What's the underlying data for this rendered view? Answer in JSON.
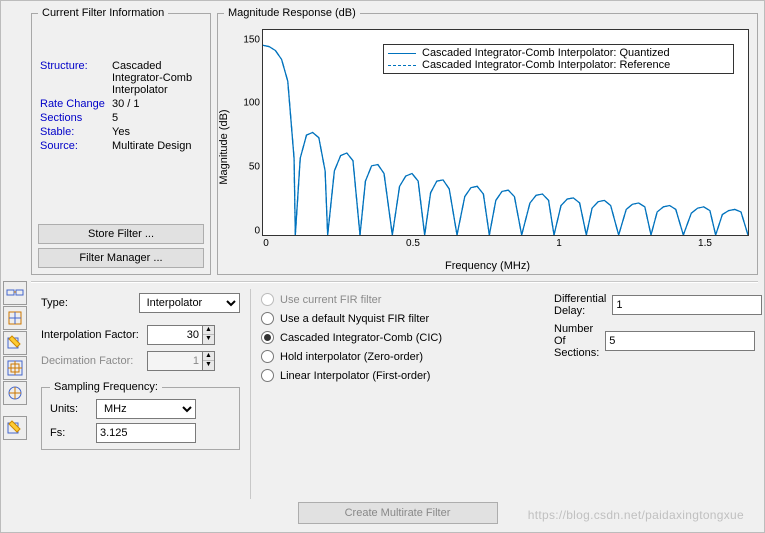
{
  "info_panel": {
    "legend": "Current Filter Information",
    "fields": {
      "structure_key": "Structure:",
      "structure_val": "Cascaded Integrator-Comb Interpolator",
      "rate_key": "Rate Change",
      "rate_val": "30 / 1",
      "sections_key": "Sections",
      "sections_val": "5",
      "stable_key": "Stable:",
      "stable_val": "Yes",
      "source_key": "Source:",
      "source_val": "Multirate Design"
    },
    "store_button": "Store Filter ...",
    "manager_button": "Filter Manager ..."
  },
  "chart": {
    "legend_title": "Magnitude Response (dB)",
    "ylabel": "Magnitude (dB)",
    "xlabel": "Frequency (MHz)",
    "xticks": [
      "0",
      "0.5",
      "1",
      "1.5"
    ],
    "yticks": [
      "0",
      "50",
      "100",
      "150"
    ],
    "legend_entries": {
      "q": "Cascaded Integrator-Comb Interpolator: Quantized",
      "r": "Cascaded Integrator-Comb Interpolator: Reference"
    }
  },
  "chart_data": {
    "type": "line",
    "title": "Magnitude Response (dB)",
    "xlabel": "Frequency (MHz)",
    "ylabel": "Magnitude (dB)",
    "xlim": [
      0,
      1.5625
    ],
    "ylim": [
      0,
      160
    ],
    "series": [
      {
        "name": "Cascaded Integrator-Comb Interpolator: Quantized",
        "style": "solid",
        "x": [
          0.0,
          0.02,
          0.04,
          0.06,
          0.08,
          0.1,
          0.1042,
          0.12,
          0.14,
          0.16,
          0.18,
          0.2,
          0.2083,
          0.23,
          0.25,
          0.27,
          0.29,
          0.3125,
          0.33,
          0.35,
          0.37,
          0.39,
          0.4167,
          0.44,
          0.46,
          0.48,
          0.5,
          0.5208,
          0.54,
          0.56,
          0.58,
          0.6,
          0.625,
          0.65,
          0.67,
          0.69,
          0.71,
          0.7292,
          0.75,
          0.77,
          0.79,
          0.81,
          0.8333,
          0.86,
          0.88,
          0.9,
          0.92,
          0.9375,
          0.96,
          0.98,
          1.0,
          1.02,
          1.0417,
          1.06,
          1.08,
          1.1,
          1.12,
          1.1458,
          1.17,
          1.19,
          1.21,
          1.23,
          1.25,
          1.27,
          1.29,
          1.31,
          1.33,
          1.3542,
          1.38,
          1.4,
          1.42,
          1.44,
          1.4583,
          1.48,
          1.5,
          1.52,
          1.54,
          1.5625
        ],
        "y": [
          148,
          147,
          144,
          137,
          120,
          60,
          0,
          60,
          78,
          80,
          76,
          50,
          0,
          50,
          62,
          64,
          58,
          0,
          42,
          54,
          55,
          48,
          0,
          38,
          46,
          48,
          42,
          0,
          33,
          42,
          43,
          36,
          0,
          30,
          37,
          38,
          32,
          0,
          27,
          34,
          35,
          30,
          0,
          25,
          31,
          32,
          27,
          0,
          23,
          28,
          29,
          25,
          0,
          21,
          26,
          27,
          23,
          0,
          20,
          24,
          25,
          22,
          0,
          18,
          22,
          23,
          20,
          0,
          17,
          21,
          22,
          19,
          0,
          16,
          19,
          20,
          18,
          0
        ]
      },
      {
        "name": "Cascaded Integrator-Comb Interpolator: Reference",
        "style": "dash-dot",
        "x": [
          0.0,
          0.02,
          0.04,
          0.06,
          0.08,
          0.1,
          0.1042,
          0.12,
          0.14,
          0.16,
          0.18,
          0.2,
          0.2083,
          0.23,
          0.25,
          0.27,
          0.29,
          0.3125,
          0.33,
          0.35,
          0.37,
          0.39,
          0.4167,
          0.44,
          0.46,
          0.48,
          0.5,
          0.5208,
          0.54,
          0.56,
          0.58,
          0.6,
          0.625,
          0.65,
          0.67,
          0.69,
          0.71,
          0.7292,
          0.75,
          0.77,
          0.79,
          0.81,
          0.8333,
          0.86,
          0.88,
          0.9,
          0.92,
          0.9375,
          0.96,
          0.98,
          1.0,
          1.02,
          1.0417,
          1.06,
          1.08,
          1.1,
          1.12,
          1.1458,
          1.17,
          1.19,
          1.21,
          1.23,
          1.25,
          1.27,
          1.29,
          1.31,
          1.33,
          1.3542,
          1.38,
          1.4,
          1.42,
          1.44,
          1.4583,
          1.48,
          1.5,
          1.52,
          1.54,
          1.5625
        ],
        "y": [
          148,
          147,
          144,
          137,
          120,
          60,
          0,
          60,
          78,
          80,
          76,
          50,
          0,
          50,
          62,
          64,
          58,
          0,
          42,
          54,
          55,
          48,
          0,
          38,
          46,
          48,
          42,
          0,
          33,
          42,
          43,
          36,
          0,
          30,
          37,
          38,
          32,
          0,
          27,
          34,
          35,
          30,
          0,
          25,
          31,
          32,
          27,
          0,
          23,
          28,
          29,
          25,
          0,
          21,
          26,
          27,
          23,
          0,
          20,
          24,
          25,
          22,
          0,
          18,
          22,
          23,
          20,
          0,
          17,
          21,
          22,
          19,
          0,
          16,
          19,
          20,
          18,
          0
        ]
      }
    ]
  },
  "design": {
    "type_label": "Type:",
    "type_value": "Interpolator",
    "interp_label": "Interpolation Factor:",
    "interp_value": "30",
    "decim_label": "Decimation Factor:",
    "decim_value": "1",
    "sampling_legend": "Sampling Frequency:",
    "units_label": "Units:",
    "units_value": "MHz",
    "fs_label": "Fs:",
    "fs_value": "3.125",
    "radios": {
      "current": "Use current FIR filter",
      "nyquist": "Use a default Nyquist FIR filter",
      "cic": "Cascaded Integrator-Comb (CIC)",
      "hold": "Hold interpolator (Zero-order)",
      "linear": "Linear Interpolator (First-order)"
    },
    "diffdelay_label": "Differential Delay:",
    "diffdelay_value": "1",
    "numsec_label": "Number Of Sections:",
    "numsec_value": "5",
    "create_button": "Create Multirate Filter"
  },
  "watermark": "https://blog.csdn.net/paidaxingtongxue"
}
